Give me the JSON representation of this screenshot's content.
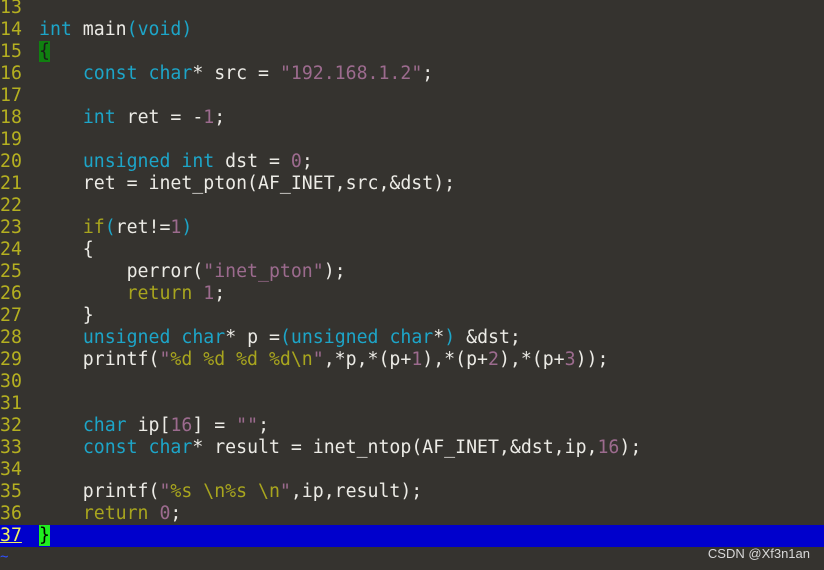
{
  "editor": {
    "current_line": 37,
    "lines": [
      {
        "no": "13",
        "tokens": []
      },
      {
        "no": "14",
        "tokens": [
          [
            "int",
            "t"
          ],
          [
            " main",
            ""
          ],
          [
            "(",
            "t"
          ],
          [
            "void",
            "t"
          ],
          [
            ")",
            "t"
          ]
        ]
      },
      {
        "no": "15",
        "tokens": [
          [
            "{",
            "b1"
          ]
        ]
      },
      {
        "no": "16",
        "tokens": [
          [
            "    ",
            ""
          ],
          [
            "const",
            "t"
          ],
          [
            " ",
            ""
          ],
          [
            "char",
            "t"
          ],
          [
            "* src = ",
            ""
          ],
          [
            "\"192.168.1.2\"",
            "s"
          ],
          [
            ";",
            ""
          ]
        ]
      },
      {
        "no": "17",
        "tokens": []
      },
      {
        "no": "18",
        "tokens": [
          [
            "    ",
            ""
          ],
          [
            "int",
            "t"
          ],
          [
            " ret = -",
            ""
          ],
          [
            "1",
            "n"
          ],
          [
            ";",
            ""
          ]
        ]
      },
      {
        "no": "19",
        "tokens": []
      },
      {
        "no": "20",
        "tokens": [
          [
            "    ",
            ""
          ],
          [
            "unsigned",
            "t"
          ],
          [
            " ",
            ""
          ],
          [
            "int",
            "t"
          ],
          [
            " dst = ",
            ""
          ],
          [
            "0",
            "n"
          ],
          [
            ";",
            ""
          ]
        ]
      },
      {
        "no": "21",
        "tokens": [
          [
            "    ret = inet_pton(AF_INET,src,&dst);",
            ""
          ]
        ]
      },
      {
        "no": "22",
        "tokens": []
      },
      {
        "no": "23",
        "tokens": [
          [
            "    ",
            ""
          ],
          [
            "if",
            "k"
          ],
          [
            "(",
            "t"
          ],
          [
            "ret!=",
            ""
          ],
          [
            "1",
            "n"
          ],
          [
            ")",
            "t"
          ]
        ]
      },
      {
        "no": "24",
        "tokens": [
          [
            "    {",
            ""
          ]
        ]
      },
      {
        "no": "25",
        "tokens": [
          [
            "        perror(",
            ""
          ],
          [
            "\"inet_pton\"",
            "s"
          ],
          [
            ");",
            ""
          ]
        ]
      },
      {
        "no": "26",
        "tokens": [
          [
            "        ",
            ""
          ],
          [
            "return",
            "k"
          ],
          [
            " ",
            ""
          ],
          [
            "1",
            "n"
          ],
          [
            ";",
            ""
          ]
        ]
      },
      {
        "no": "27",
        "tokens": [
          [
            "    }",
            ""
          ]
        ]
      },
      {
        "no": "28",
        "tokens": [
          [
            "    ",
            ""
          ],
          [
            "unsigned",
            "t"
          ],
          [
            " ",
            ""
          ],
          [
            "char",
            "t"
          ],
          [
            "* p =",
            ""
          ],
          [
            "(",
            "t"
          ],
          [
            "unsigned",
            "t"
          ],
          [
            " ",
            ""
          ],
          [
            "char",
            "t"
          ],
          [
            "*",
            ""
          ],
          [
            ")",
            "t"
          ],
          [
            " &dst;",
            ""
          ]
        ]
      },
      {
        "no": "29",
        "tokens": [
          [
            "    printf(",
            ""
          ],
          [
            "\"",
            "s"
          ],
          [
            "%d %d %d %d\\n",
            "f"
          ],
          [
            "\"",
            "s"
          ],
          [
            ",*p,*(p+",
            ""
          ],
          [
            "1",
            "n"
          ],
          [
            "),*(p+",
            ""
          ],
          [
            "2",
            "n"
          ],
          [
            "),*(p+",
            ""
          ],
          [
            "3",
            "n"
          ],
          [
            "));",
            ""
          ]
        ]
      },
      {
        "no": "30",
        "tokens": []
      },
      {
        "no": "31",
        "tokens": []
      },
      {
        "no": "32",
        "tokens": [
          [
            "    ",
            ""
          ],
          [
            "char",
            "t"
          ],
          [
            " ip[",
            ""
          ],
          [
            "16",
            "n"
          ],
          [
            "] = ",
            ""
          ],
          [
            "\"\"",
            "s"
          ],
          [
            ";",
            ""
          ]
        ]
      },
      {
        "no": "33",
        "tokens": [
          [
            "    ",
            ""
          ],
          [
            "const",
            "t"
          ],
          [
            " ",
            ""
          ],
          [
            "char",
            "t"
          ],
          [
            "* result = inet_ntop(AF_INET,&dst,ip,",
            ""
          ],
          [
            "16",
            "n"
          ],
          [
            ");",
            ""
          ]
        ]
      },
      {
        "no": "34",
        "tokens": []
      },
      {
        "no": "35",
        "tokens": [
          [
            "    printf(",
            ""
          ],
          [
            "\"",
            "s"
          ],
          [
            "%s \\n%s \\n",
            "f"
          ],
          [
            "\"",
            "s"
          ],
          [
            ",ip,result);",
            ""
          ]
        ]
      },
      {
        "no": "36",
        "tokens": [
          [
            "    ",
            ""
          ],
          [
            "return",
            "k"
          ],
          [
            " ",
            ""
          ],
          [
            "0",
            "n"
          ],
          [
            ";",
            ""
          ]
        ]
      },
      {
        "no": "37",
        "tokens": [
          [
            "}",
            "b2"
          ]
        ]
      }
    ]
  },
  "tilde": "~",
  "watermark": "CSDN @Xf3n1an"
}
